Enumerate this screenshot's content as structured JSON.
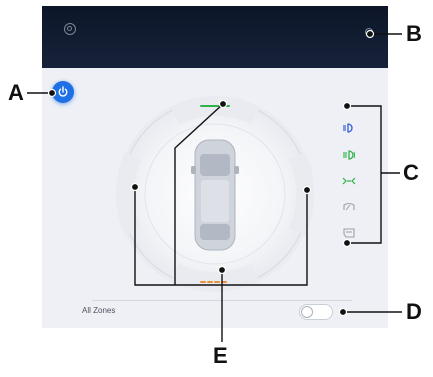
{
  "settings": {
    "all_zones_label": "All Zones",
    "all_zones_toggle_on": false
  },
  "callouts": {
    "a": "A",
    "b": "B",
    "c": "C",
    "d": "D",
    "e": "E"
  },
  "icons": {
    "top_left": "settings-icon",
    "top_right": "info-icon",
    "power": "power-icon",
    "indicators": [
      "low-beam-icon",
      "fog-light-icon",
      "parking-light-icon",
      "wiper-icon",
      "door-icon"
    ]
  },
  "colors": {
    "accent_blue": "#1f6fe5",
    "zone_front_green": "#2fb24a",
    "zone_rear_orange": "#e8913a",
    "indicator_blue": "#2f5fd6",
    "indicator_green": "#2fb24a",
    "indicator_grey": "#9aa1ad"
  }
}
